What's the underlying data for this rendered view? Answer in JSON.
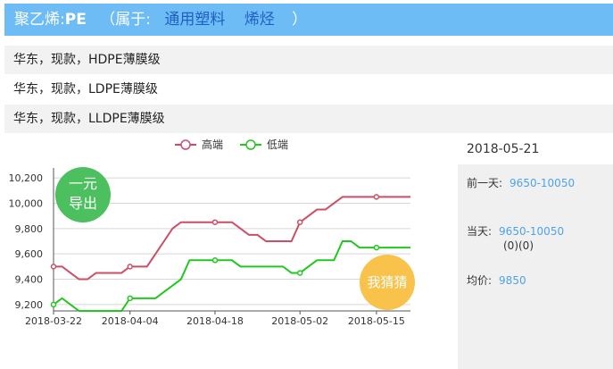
{
  "header": {
    "name": "聚乙烯:",
    "code": "PE",
    "paren_open": "（属于:",
    "cat1": "通用塑料",
    "cat2": "烯烃",
    "paren_close": "）"
  },
  "specs": [
    "华东，现款，HDPE薄膜级",
    "华东，现款，LDPE薄膜级",
    "华东，现款，LLDPE薄膜级"
  ],
  "badges": {
    "export": [
      "一元",
      "导出"
    ],
    "guess": "我猜猜"
  },
  "side": {
    "date": "2018-05-21",
    "prev_label": "前一天:",
    "prev_value": "9650-10050",
    "today_label": "当天:",
    "today_value": "9650-10050",
    "change": "(0)(0)",
    "avg_label": "均价:",
    "avg_value": "9850"
  },
  "chart_data": {
    "type": "line",
    "ylim": [
      9150,
      10250
    ],
    "yticks": [
      9200,
      9400,
      9600,
      9800,
      10000,
      10200
    ],
    "ytick_labels": [
      "9,200",
      "9,400",
      "9,600",
      "9,800",
      "10,000",
      "10,200"
    ],
    "xtick_labels": [
      "2018-03-22",
      "2018-04-04",
      "2018-04-18",
      "2018-05-02",
      "2018-05-15"
    ],
    "xtick_index": [
      0,
      9,
      19,
      29,
      38
    ],
    "x_count": 43,
    "series": [
      {
        "name": "高端",
        "color": "#cc4e66",
        "values": [
          9500,
          9500,
          9450,
          9400,
          9400,
          9450,
          9450,
          9450,
          9450,
          9500,
          9500,
          9500,
          9600,
          9700,
          9800,
          9850,
          9850,
          9850,
          9850,
          9850,
          9850,
          9850,
          9800,
          9750,
          9750,
          9700,
          9700,
          9700,
          9700,
          9850,
          9900,
          9950,
          9950,
          10000,
          10050,
          10050,
          10050,
          10050,
          10050,
          10050,
          10050,
          10050,
          10050
        ],
        "marked": [
          0,
          9,
          19,
          29,
          38
        ]
      },
      {
        "name": "低端",
        "color": "#22c71f",
        "values": [
          9200,
          9250,
          9200,
          9150,
          9150,
          9150,
          9150,
          9150,
          9150,
          9250,
          9250,
          9250,
          9250,
          9300,
          9350,
          9400,
          9550,
          9550,
          9550,
          9550,
          9550,
          9550,
          9500,
          9500,
          9500,
          9500,
          9500,
          9500,
          9450,
          9450,
          9500,
          9550,
          9550,
          9550,
          9700,
          9700,
          9650,
          9650,
          9650,
          9650,
          9650,
          9650,
          9650
        ],
        "marked": [
          0,
          9,
          19,
          29,
          38
        ]
      }
    ]
  }
}
